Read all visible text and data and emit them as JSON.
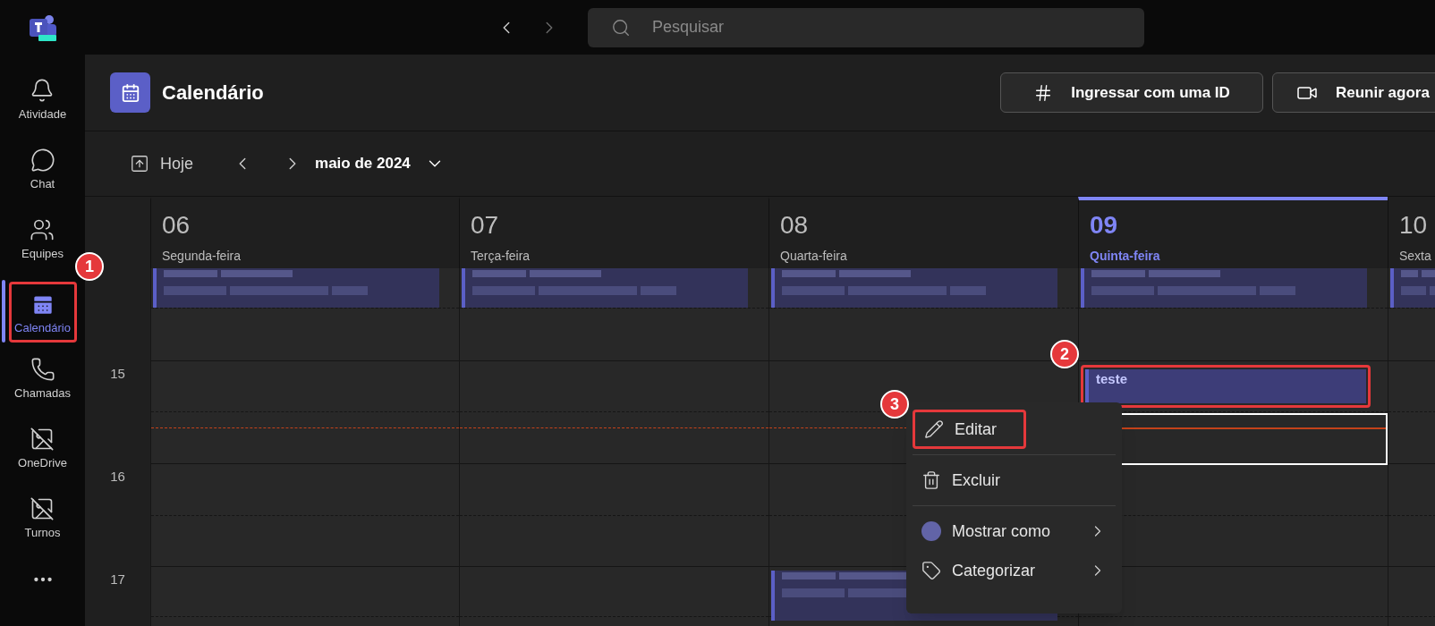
{
  "search": {
    "placeholder": "Pesquisar"
  },
  "rail": {
    "items": [
      {
        "label": "Atividade",
        "selected": false,
        "highlighted": false
      },
      {
        "label": "Chat",
        "selected": false,
        "highlighted": false
      },
      {
        "label": "Equipes",
        "selected": false,
        "highlighted": false
      },
      {
        "label": "Calendário",
        "selected": true,
        "highlighted": true
      },
      {
        "label": "Chamadas",
        "selected": false,
        "highlighted": false
      },
      {
        "label": "OneDrive",
        "selected": false,
        "highlighted": false
      },
      {
        "label": "Turnos",
        "selected": false,
        "highlighted": false
      }
    ]
  },
  "header": {
    "title": "Calendário",
    "buttons": [
      {
        "kind": "join",
        "label": "Ingressar com uma ID"
      },
      {
        "kind": "meet",
        "label": "Reunir agora"
      }
    ]
  },
  "toolbar": {
    "today": "Hoje",
    "period": "maio de 2024"
  },
  "days": [
    {
      "number": "06",
      "name": "Segunda-feira",
      "selected": false
    },
    {
      "number": "07",
      "name": "Terça-feira",
      "selected": false
    },
    {
      "number": "08",
      "name": "Quarta-feira",
      "selected": false
    },
    {
      "number": "09",
      "name": "Quinta-feira",
      "selected": true
    },
    {
      "number": "10",
      "name": "Sexta",
      "selected": false
    }
  ],
  "hours": [
    "15",
    "16",
    "17"
  ],
  "event": {
    "title": "teste",
    "highlighted": true
  },
  "context_menu": {
    "groups": [
      [
        {
          "kind": "edit",
          "label": "Editar",
          "submenu": false,
          "highlighted": true
        }
      ],
      [
        {
          "kind": "delete",
          "label": "Excluir",
          "submenu": false,
          "highlighted": false
        }
      ],
      [
        {
          "kind": "show_as",
          "label": "Mostrar como",
          "submenu": true,
          "highlighted": false
        },
        {
          "kind": "categorize",
          "label": "Categorizar",
          "submenu": true,
          "highlighted": false
        }
      ]
    ]
  },
  "annotations": [
    "1",
    "2",
    "3"
  ]
}
